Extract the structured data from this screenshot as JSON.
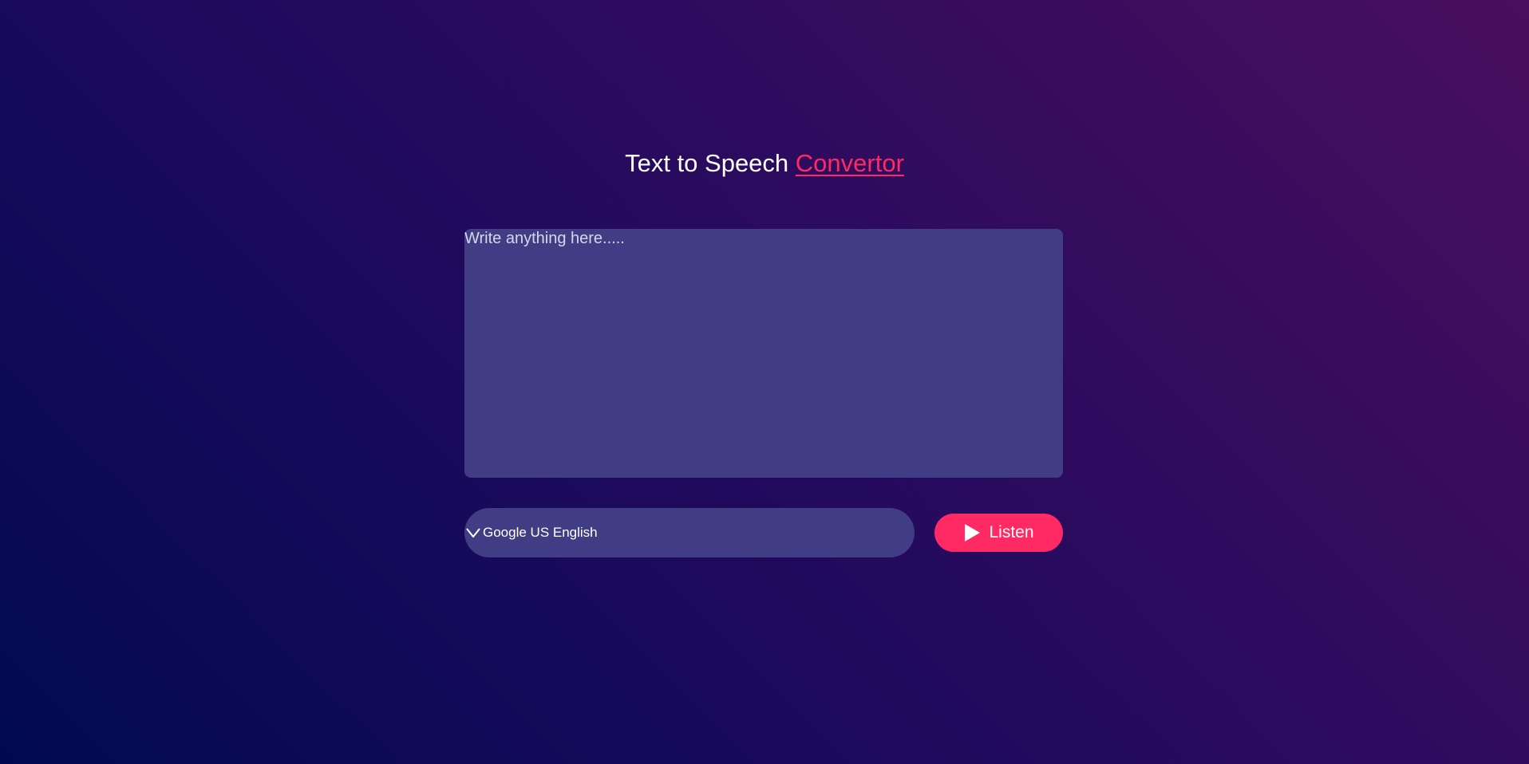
{
  "header": {
    "title_main": "Text to Speech",
    "title_accent": "Convertor"
  },
  "input": {
    "placeholder": "Write anything here.....",
    "value": ""
  },
  "voice_select": {
    "selected": "Google US English",
    "icon": "chevron-down-icon"
  },
  "listen_button": {
    "label": "Listen",
    "icon": "play-icon"
  },
  "colors": {
    "accent": "#ff2963",
    "panel": "#403d84",
    "text": "#ffffff"
  }
}
